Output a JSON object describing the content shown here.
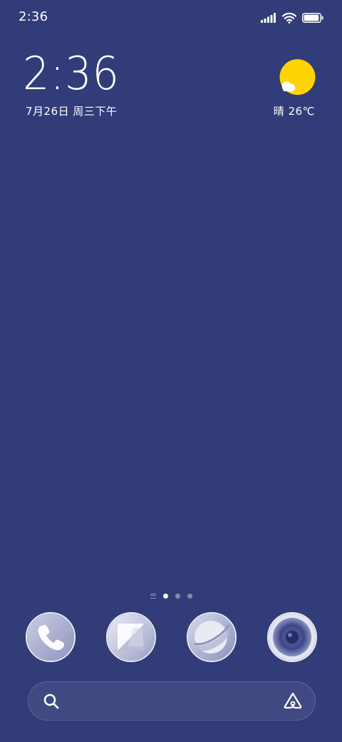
{
  "status_bar": {
    "time": "2:36",
    "icons": [
      "signal-icon",
      "wifi-icon",
      "battery-icon"
    ],
    "battery_level": 0.95
  },
  "clock_widget": {
    "time": "2:36",
    "date": "7月26日 周三下午"
  },
  "weather_widget": {
    "icon": "sun-cloud-icon",
    "text": "晴 26℃"
  },
  "page_indicator": {
    "pages": 3,
    "active_page": 1
  },
  "dock": {
    "apps": [
      {
        "name": "phone",
        "icon": "phone-icon"
      },
      {
        "name": "messages",
        "icon": "messages-icon"
      },
      {
        "name": "browser",
        "icon": "browser-icon"
      },
      {
        "name": "camera",
        "icon": "camera-icon"
      }
    ]
  },
  "search_bar": {
    "icon": "search-icon",
    "assistant_icon": "assistant-icon"
  },
  "colors": {
    "wallpaper": "#323c78",
    "sun": "#ffd400",
    "text": "#ffffff"
  }
}
